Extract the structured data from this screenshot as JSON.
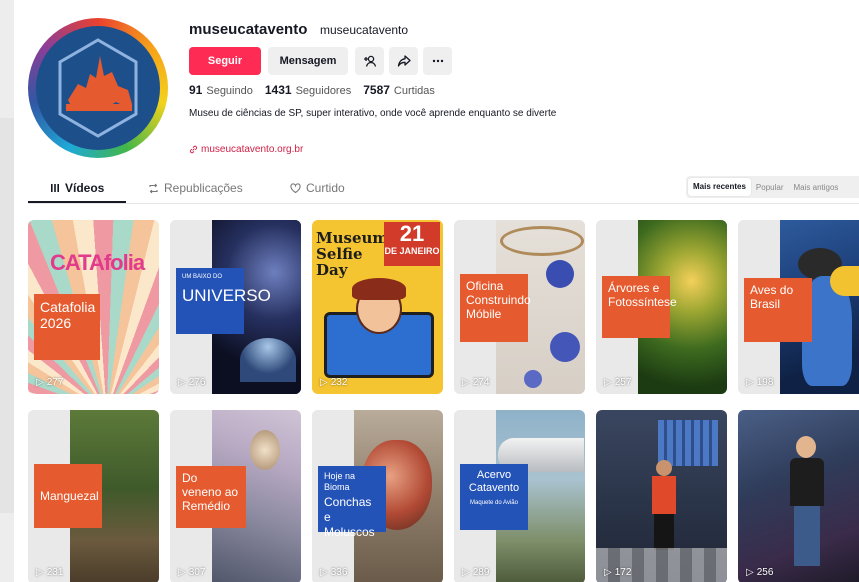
{
  "profile": {
    "username": "museucatavento",
    "nickname": "museucatavento",
    "follow_label": "Seguir",
    "message_label": "Mensagem",
    "stats": [
      {
        "value": "91",
        "label": "Seguindo"
      },
      {
        "value": "1431",
        "label": "Seguidores"
      },
      {
        "value": "7587",
        "label": "Curtidas"
      }
    ],
    "bio": "Museu de ciências de SP, super interativo, onde você aprende enquanto se diverte",
    "link": "museucatavento.org.br"
  },
  "tabs": [
    {
      "label": "Vídeos",
      "icon": "grid-icon"
    },
    {
      "label": "Republicações",
      "icon": "repost-icon"
    },
    {
      "label": "Curtido",
      "icon": "heart-icon"
    }
  ],
  "sort": [
    "Mais recentes",
    "Popular",
    "Mais antigos"
  ],
  "colors": {
    "accent": "#fe2c55",
    "label_orange": "#e55a2e",
    "label_blue": "#2453b8"
  },
  "videos": [
    {
      "label": "Catafolia 2026",
      "headline": "CATAfolia",
      "views": "277"
    },
    {
      "label": "UNIVERSO",
      "tag": "UM BAIXO DO",
      "views": "276"
    },
    {
      "label": "Museum Selfie Day",
      "date_num": "21",
      "date_word": "DE JANEIRO",
      "views": "232"
    },
    {
      "label": "Oficina Construindo Móbile",
      "views": "274"
    },
    {
      "label": "Árvores e Fotossíntese",
      "views": "257"
    },
    {
      "label": "Aves do Brasil",
      "views": "198"
    },
    {
      "label": "Manguezal",
      "views": "231"
    },
    {
      "label": "Do veneno ao Remédio",
      "views": "307"
    },
    {
      "label": "Conchas e Moluscos",
      "tag": "Hoje na Bioma",
      "views": "336"
    },
    {
      "label": "Acervo Catavento",
      "sub": "Maquete do Avião",
      "views": "289"
    },
    {
      "label": "",
      "views": "172"
    },
    {
      "label": "",
      "views": "256"
    }
  ]
}
